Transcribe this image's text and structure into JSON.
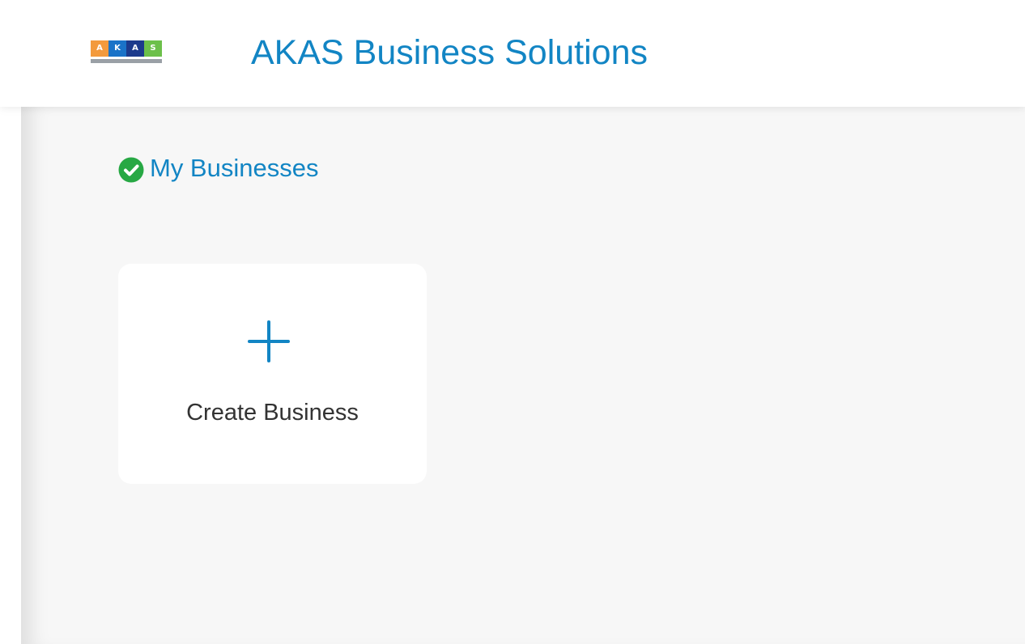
{
  "header": {
    "logo": {
      "letters": [
        "A",
        "K",
        "A",
        "S"
      ],
      "colors": [
        "#f39a3d",
        "#1a73c8",
        "#1c3a8c",
        "#6cc04a"
      ]
    },
    "title": "AKAS Business Solutions"
  },
  "main": {
    "heading": {
      "label": "My Businesses",
      "icon": "check-circle-icon",
      "icon_color": "#27a844"
    },
    "create_card": {
      "label": "Create Business",
      "icon": "plus-icon"
    }
  },
  "colors": {
    "accent": "#1285c4",
    "background": "#f7f7f7",
    "card": "#ffffff",
    "text": "#333333"
  }
}
